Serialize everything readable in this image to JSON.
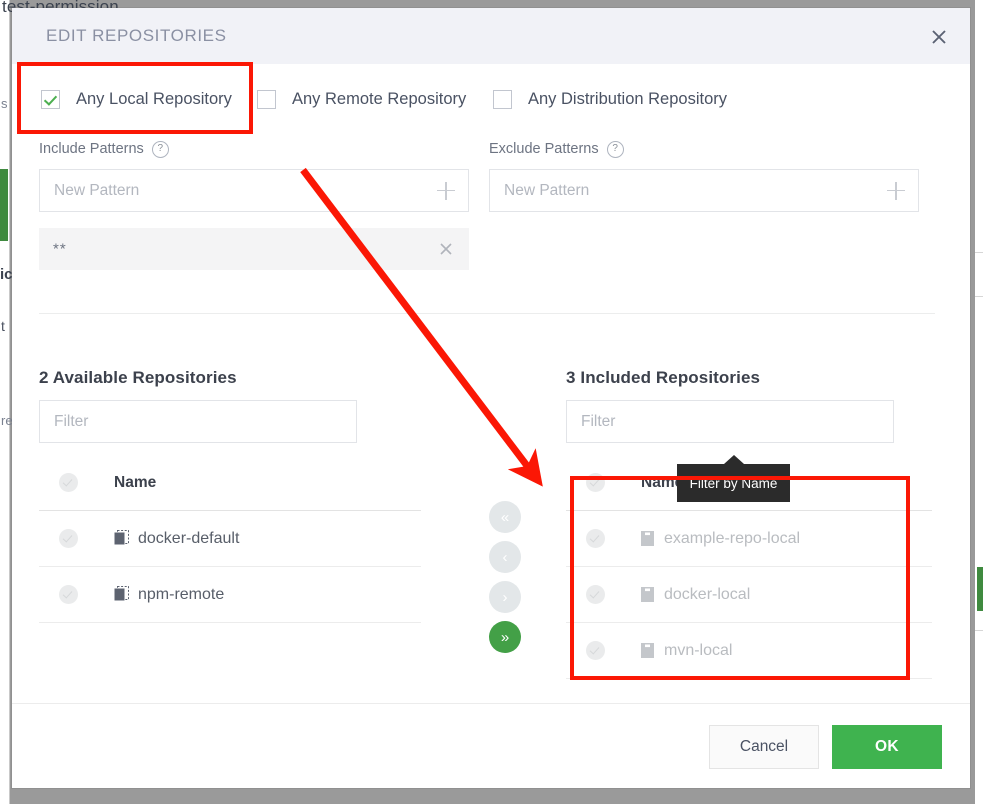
{
  "background": {
    "top_text": "test-permission",
    "fragments": [
      "s",
      "ic",
      "t",
      "re"
    ]
  },
  "modal": {
    "title": "EDIT REPOSITORIES",
    "close_icon": "close-icon",
    "checkboxes": [
      {
        "label": "Any Local Repository",
        "checked": true
      },
      {
        "label": "Any Remote Repository",
        "checked": false
      },
      {
        "label": "Any Distribution Repository",
        "checked": false
      }
    ],
    "include_patterns": {
      "label": "Include Patterns",
      "help_icon": "question-mark-icon",
      "placeholder": "New Pattern",
      "add_icon": "plus-icon",
      "chips": [
        {
          "value": "**",
          "remove_icon": "close-icon"
        }
      ]
    },
    "exclude_patterns": {
      "label": "Exclude Patterns",
      "help_icon": "question-mark-icon",
      "placeholder": "New Pattern",
      "add_icon": "plus-icon",
      "chips": []
    },
    "available_panel": {
      "title": "2 Available Repositories",
      "filter_placeholder": "Filter",
      "column_header": "Name",
      "rows": [
        {
          "name": "docker-default",
          "icon": "remote-repository-icon"
        },
        {
          "name": "npm-remote",
          "icon": "remote-repository-icon"
        }
      ]
    },
    "included_panel": {
      "title": "3 Included Repositories",
      "filter_placeholder": "Filter",
      "column_header": "Name",
      "rows": [
        {
          "name": "example-repo-local",
          "icon": "local-repository-icon"
        },
        {
          "name": "docker-local",
          "icon": "local-repository-icon"
        },
        {
          "name": "mvn-local",
          "icon": "local-repository-icon"
        }
      ]
    },
    "transfer_buttons": [
      {
        "glyph": "«",
        "name": "move-all-left-button",
        "accent": false
      },
      {
        "glyph": "‹",
        "name": "move-left-button",
        "accent": false
      },
      {
        "glyph": "›",
        "name": "move-right-button",
        "accent": false
      },
      {
        "glyph": "»",
        "name": "move-all-right-button",
        "accent": true
      }
    ],
    "tooltip": "Filter by Name",
    "footer": {
      "cancel_label": "Cancel",
      "ok_label": "OK"
    }
  },
  "colors": {
    "accent_green": "#3fb34f",
    "transfer_green": "#43a047",
    "annotation_red": "#fb1705",
    "header_bg": "#f1f2f7",
    "title_gray": "#8a90a3"
  }
}
